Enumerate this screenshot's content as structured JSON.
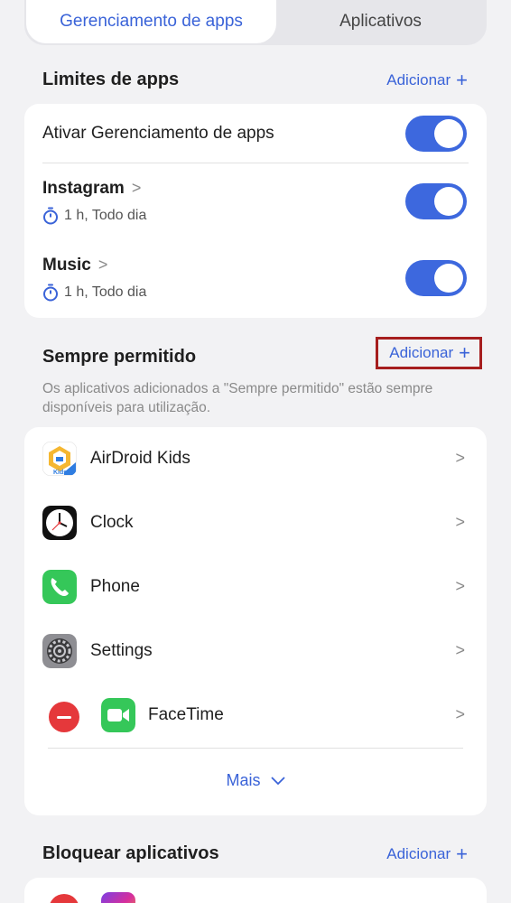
{
  "tabs": {
    "active": "Gerenciamento de apps",
    "inactive": "Aplicativos"
  },
  "limits": {
    "title": "Limites de apps",
    "add_label": "Adicionar",
    "master_label": "Ativar Gerenciamento de apps",
    "items": [
      {
        "name": "Instagram",
        "detail": "1 h, Todo dia",
        "enabled": true
      },
      {
        "name": "Music",
        "detail": "1 h, Todo dia",
        "enabled": true
      }
    ]
  },
  "always_allowed": {
    "title": "Sempre permitido",
    "add_label": "Adicionar",
    "description": "Os aplicativos adicionados a \"Sempre permitido\" estão sempre disponíveis para utilização.",
    "apps": [
      {
        "name": "AirDroid Kids",
        "icon": "airdroid-kids-icon"
      },
      {
        "name": "Clock",
        "icon": "clock-icon"
      },
      {
        "name": "Phone",
        "icon": "phone-icon"
      },
      {
        "name": "Settings",
        "icon": "settings-icon"
      },
      {
        "name": "FaceTime",
        "icon": "facetime-icon"
      }
    ],
    "more_label": "Mais",
    "airdroid_badge": "Kids"
  },
  "block": {
    "title": "Bloquear aplicativos",
    "add_label": "Adicionar"
  },
  "colors": {
    "accent": "#3d68de",
    "link": "#3a63d8",
    "highlight": "#a61e1e",
    "remove": "#e5383b"
  }
}
